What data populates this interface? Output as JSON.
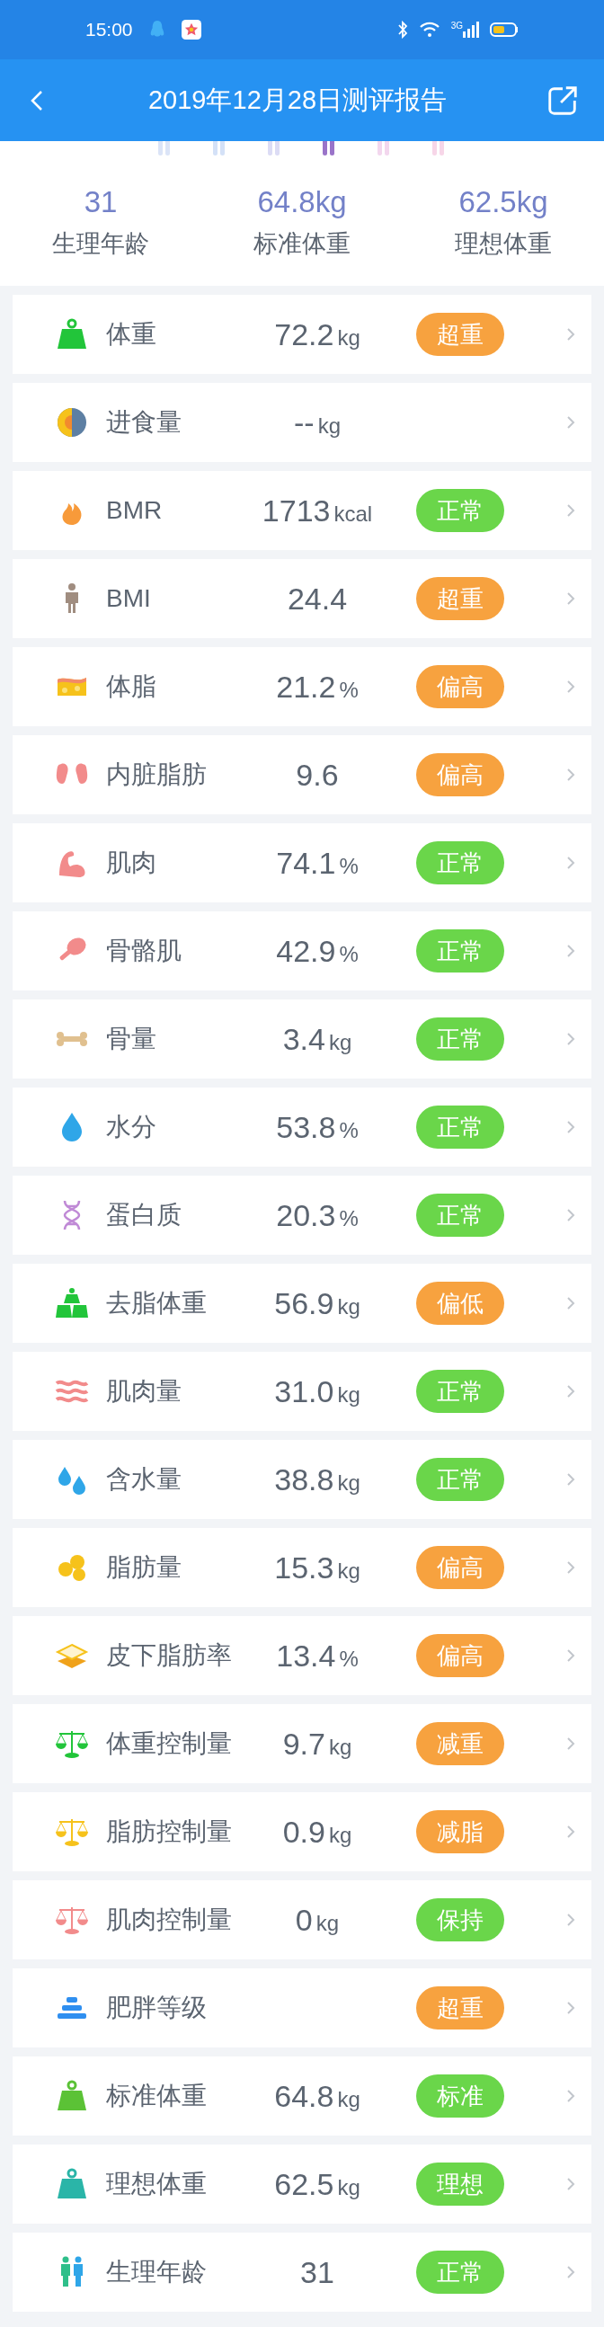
{
  "status_bar": {
    "time": "15:00",
    "network": "3G"
  },
  "app_bar": {
    "title": "2019年12月28日测评报告"
  },
  "summary": [
    {
      "value": "31",
      "label": "生理年龄"
    },
    {
      "value": "64.8kg",
      "label": "标准体重"
    },
    {
      "value": "62.5kg",
      "label": "理想体重"
    }
  ],
  "rows": [
    {
      "label": "体重",
      "value": "72.2",
      "unit": "kg",
      "status": "超重",
      "color": "#f7a23f"
    },
    {
      "label": "进食量",
      "value": "--",
      "unit": "kg"
    },
    {
      "label": "BMR",
      "value": "1713",
      "unit": "kcal",
      "status": "正常",
      "color": "#6ad64a"
    },
    {
      "label": "BMI",
      "value": "24.4",
      "status": "超重",
      "color": "#f7a23f"
    },
    {
      "label": "体脂",
      "value": "21.2",
      "unit": "%",
      "status": "偏高",
      "color": "#f7a23f"
    },
    {
      "label": "内脏脂肪",
      "value": "9.6",
      "status": "偏高",
      "color": "#f7a23f"
    },
    {
      "label": "肌肉",
      "value": "74.1",
      "unit": "%",
      "status": "正常",
      "color": "#6ad64a"
    },
    {
      "label": "骨骼肌",
      "value": "42.9",
      "unit": "%",
      "status": "正常",
      "color": "#6ad64a"
    },
    {
      "label": "骨量",
      "value": "3.4",
      "unit": "kg",
      "status": "正常",
      "color": "#6ad64a"
    },
    {
      "label": "水分",
      "value": "53.8",
      "unit": "%",
      "status": "正常",
      "color": "#6ad64a"
    },
    {
      "label": "蛋白质",
      "value": "20.3",
      "unit": "%",
      "status": "正常",
      "color": "#6ad64a"
    },
    {
      "label": "去脂体重",
      "value": "56.9",
      "unit": "kg",
      "status": "偏低",
      "color": "#f7a23f"
    },
    {
      "label": "肌肉量",
      "value": "31.0",
      "unit": "kg",
      "status": "正常",
      "color": "#6ad64a"
    },
    {
      "label": "含水量",
      "value": "38.8",
      "unit": "kg",
      "status": "正常",
      "color": "#6ad64a"
    },
    {
      "label": "脂肪量",
      "value": "15.3",
      "unit": "kg",
      "status": "偏高",
      "color": "#f7a23f"
    },
    {
      "label": "皮下脂肪率",
      "value": "13.4",
      "unit": "%",
      "status": "偏高",
      "color": "#f7a23f"
    },
    {
      "label": "体重控制量",
      "value": "9.7",
      "unit": "kg",
      "status": "减重",
      "color": "#f7a23f"
    },
    {
      "label": "脂肪控制量",
      "value": "0.9",
      "unit": "kg",
      "status": "减脂",
      "color": "#f7a23f"
    },
    {
      "label": "肌肉控制量",
      "value": "0",
      "unit": "kg",
      "status": "保持",
      "color": "#6ad64a"
    },
    {
      "label": "肥胖等级",
      "status": "超重",
      "color": "#f7a23f"
    },
    {
      "label": "标准体重",
      "value": "64.8",
      "unit": "kg",
      "status": "标准",
      "color": "#6ad64a"
    },
    {
      "label": "理想体重",
      "value": "62.5",
      "unit": "kg",
      "status": "理想",
      "color": "#6ad64a"
    },
    {
      "label": "生理年龄",
      "value": "31",
      "status": "正常",
      "color": "#6ad64a"
    }
  ]
}
